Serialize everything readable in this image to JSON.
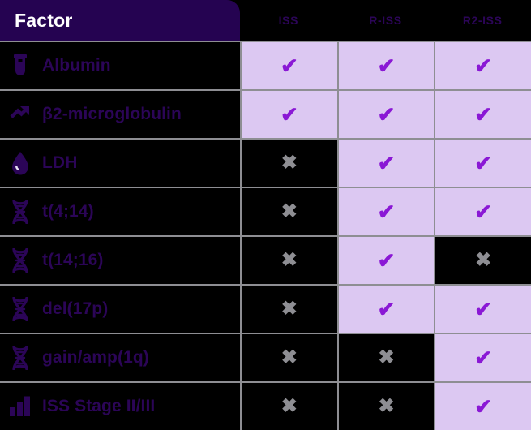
{
  "header": {
    "factor_label": "Factor",
    "columns": [
      {
        "label": "ISS"
      },
      {
        "label": "R-ISS"
      },
      {
        "label": "R2-ISS"
      }
    ]
  },
  "colors": {
    "header_bg": "#250351",
    "header_text": "#ffffff",
    "column_header_text": "#2b0557",
    "cell_yes_bg": "#dcc8f2",
    "cell_no_bg": "#000000",
    "check_color": "#8a18d5",
    "cross_color": "#8e8e93",
    "grid_line": "#8e8e93",
    "factor_text": "#2b0557",
    "page_bg": "#000000"
  },
  "glyphs": {
    "check": "✔",
    "cross": "✖"
  },
  "rows": [
    {
      "icon": "test-tube-icon",
      "label": "Albumin",
      "iss": "check",
      "riss": "check",
      "r2iss": "check"
    },
    {
      "icon": "trending-up-icon",
      "label": "β2-microglobulin",
      "iss": "check",
      "riss": "check",
      "r2iss": "check"
    },
    {
      "icon": "blood-drop-icon",
      "label": "LDH",
      "iss": "cross",
      "riss": "check",
      "r2iss": "check"
    },
    {
      "icon": "dna-icon",
      "label": "t(4;14)",
      "iss": "cross",
      "riss": "check",
      "r2iss": "check"
    },
    {
      "icon": "dna-icon",
      "label": "t(14;16)",
      "iss": "cross",
      "riss": "check",
      "r2iss": "cross"
    },
    {
      "icon": "dna-icon",
      "label": "del(17p)",
      "iss": "cross",
      "riss": "check",
      "r2iss": "check"
    },
    {
      "icon": "dna-icon",
      "label": "gain/amp(1q)",
      "iss": "cross",
      "riss": "cross",
      "r2iss": "check"
    },
    {
      "icon": "bar-chart-icon",
      "label": "ISS Stage II/III",
      "iss": "cross",
      "riss": "cross",
      "r2iss": "check"
    }
  ]
}
